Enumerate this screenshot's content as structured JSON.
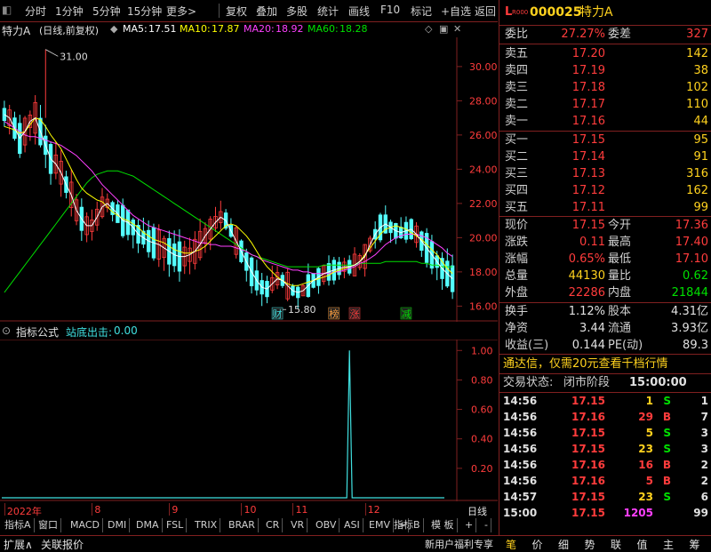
{
  "toolbar": {
    "left_items": [
      "分时",
      "1分钟",
      "5分钟",
      "15分钟",
      "更多>"
    ],
    "right_items": [
      "复权",
      "叠加",
      "多股",
      "统计",
      "画线",
      "F10",
      "标记",
      "+自选",
      "返回"
    ]
  },
  "chart_header": {
    "stock": "特力A",
    "mode": "(日线,前复权)",
    "ma5_label": "MA5:",
    "ma5": "17.51",
    "ma10_label": "MA10:",
    "ma10": "17.87",
    "ma20_label": "MA20:",
    "ma20": "18.92",
    "ma60_label": "MA60:",
    "ma60": "18.28"
  },
  "colors": {
    "up": "#ff3c3c",
    "down": "#54ffff",
    "ma5": "#ffffff",
    "ma10": "#ffff00",
    "ma20": "#ff40ff",
    "ma60": "#00e000",
    "frame": "#802020"
  },
  "chart_data": {
    "type": "candlestick",
    "ylim": [
      15.5,
      31.5
    ],
    "y_ticks": [
      "30.00",
      "28.00",
      "26.00",
      "24.00",
      "22.00",
      "20.00",
      "18.00",
      "16.00"
    ],
    "y_tick_values": [
      30,
      28,
      26,
      24,
      22,
      20,
      18,
      16
    ],
    "max_marker": "31.00",
    "min_marker": "15.80",
    "ma5": [
      27.2,
      27,
      26.4,
      25.8,
      26.2,
      26.8,
      27,
      26.2,
      25.4,
      24.6,
      24.3,
      23.8,
      23.1,
      22.5,
      21.6,
      21.1,
      20.7,
      20.7,
      21.2,
      21.8,
      22,
      21.7,
      21.4,
      21,
      20.9,
      20.6,
      20.2,
      20,
      19.8,
      19.7,
      19.6,
      19.4,
      19.2,
      19,
      18.9,
      18.9,
      19,
      19.2,
      19.6,
      20.1,
      20.5,
      20.9,
      21.2,
      21,
      20.4,
      19.8,
      19.2,
      18.6,
      18,
      17.5,
      17.1,
      17,
      17.3,
      17.6,
      17.5,
      17.2,
      16.9,
      16.8,
      16.9,
      17.2,
      17.5,
      17.7,
      17.9,
      18,
      18.1,
      18.2,
      18.3,
      18.3,
      18.4,
      18.6,
      18.9,
      19.6,
      20.2,
      20.6,
      20.8,
      20.6,
      20.4,
      20.3,
      20.4,
      20.5,
      20.2,
      19.8,
      19.4,
      19,
      18.6,
      18.2,
      17.9,
      17.6
    ],
    "ma10": [
      26.5,
      26.4,
      26.3,
      26.1,
      26.2,
      26.6,
      27,
      26.9,
      26.5,
      26,
      25.6,
      25.2,
      24.6,
      24,
      23.4,
      22.9,
      22.6,
      22.4,
      22.2,
      22.1,
      21.8,
      21.5,
      21.3,
      21.1,
      21,
      20.8,
      20.6,
      20.3,
      20.1,
      19.9,
      19.8,
      19.7,
      19.5,
      19.3,
      19.2,
      19.1,
      19.1,
      19.2,
      19.3,
      19.5,
      19.8,
      20.1,
      20.4,
      20.7,
      20.8,
      20.7,
      20.4,
      20.1,
      19.7,
      19.2,
      18.7,
      18.3,
      18,
      17.7,
      17.5,
      17.3,
      17.2,
      17.2,
      17.3,
      17.4,
      17.5,
      17.6,
      17.7,
      17.8,
      18,
      18.1,
      18.2,
      18.3,
      18.4,
      18.6,
      19,
      19.4,
      19.8,
      20.2,
      20.5,
      20.6,
      20.7,
      20.6,
      20.5,
      20.3,
      20.1,
      19.9,
      19.6,
      19.3,
      19,
      18.6,
      18.2,
      17.9
    ],
    "ma20": [
      26.8,
      26.6,
      26.4,
      26.2,
      26,
      25.9,
      25.9,
      25.8,
      25.7,
      25.6,
      25.5,
      25.4,
      25.2,
      25,
      24.8,
      24.5,
      24.2,
      23.9,
      23.5,
      23.1,
      22.8,
      22.5,
      22.2,
      21.9,
      21.6,
      21.3,
      21.1,
      20.9,
      20.7,
      20.6,
      20.5,
      20.4,
      20.3,
      20.2,
      20.1,
      20,
      19.9,
      19.8,
      19.7,
      19.7,
      19.6,
      19.6,
      19.5,
      19.5,
      19.5,
      19.4,
      19.3,
      19.2,
      19,
      18.9,
      18.7,
      18.6,
      18.5,
      18.4,
      18.3,
      18.2,
      18.1,
      18.1,
      18,
      18,
      17.9,
      17.9,
      17.9,
      17.9,
      18,
      18,
      18.1,
      18.2,
      18.3,
      18.5,
      18.6,
      18.8,
      19,
      19.3,
      19.6,
      19.8,
      20,
      20.1,
      20.2,
      20.2,
      20.2,
      20.1,
      20,
      19.8,
      19.6,
      19.4,
      19.1,
      18.9
    ],
    "ma60": [
      16.8,
      17.2,
      17.6,
      18,
      18.4,
      18.8,
      19.2,
      19.6,
      20,
      20.4,
      20.8,
      21.2,
      21.6,
      22,
      22.4,
      22.8,
      23.2,
      23.5,
      23.7,
      23.8,
      23.9,
      23.9,
      23.9,
      23.8,
      23.7,
      23.6,
      23.4,
      23.2,
      23,
      22.8,
      22.6,
      22.4,
      22.2,
      22,
      21.8,
      21.6,
      21.4,
      21.2,
      21,
      20.8,
      20.6,
      20.4,
      20.2,
      20,
      19.8,
      19.6,
      19.4,
      19.2,
      19,
      18.9,
      18.8,
      18.7,
      18.6,
      18.5,
      18.4,
      18.3,
      18.3,
      18.3,
      18.3,
      18.3,
      18.3,
      18.3,
      18.4,
      18.4,
      18.4,
      18.4,
      18.4,
      18.4,
      18.4,
      18.5,
      18.5,
      18.5,
      18.5,
      18.5,
      18.6,
      18.6,
      18.6,
      18.6,
      18.6,
      18.6,
      18.6,
      18.5,
      18.5,
      18.4,
      18.4,
      18.3,
      18.3,
      18.3
    ],
    "event_markers": [
      {
        "label": "财",
        "index": 53,
        "color": "#40e0e0"
      },
      {
        "label": "榜",
        "index": 64,
        "color": "#ffa040"
      },
      {
        "label": "涨",
        "index": 68,
        "color": "#ff3c3c"
      },
      {
        "label": "减",
        "index": 78,
        "color": "#00e000"
      }
    ],
    "x_labels": [
      {
        "label": "2022年",
        "index": 0
      },
      {
        "label": "8",
        "index": 17
      },
      {
        "label": "9",
        "index": 32
      },
      {
        "label": "10",
        "index": 46
      },
      {
        "label": "11",
        "index": 56
      },
      {
        "label": "12",
        "index": 70
      }
    ]
  },
  "indicator": {
    "title": "指标公式",
    "name": "站底出击:",
    "value": "0.00",
    "y_ticks": [
      "1.00",
      "0.80",
      "0.60",
      "0.40",
      "0.20"
    ],
    "y_tick_values": [
      1,
      0.8,
      0.6,
      0.4,
      0.2
    ],
    "spike_index": 67,
    "spike_value": 1.0,
    "right_label": "日线"
  },
  "bottom_tabs": [
    "指标A",
    "窗口",
    "MACD",
    "DMI",
    "DMA",
    "FSL",
    "TRIX",
    "BRAR",
    "CR",
    "VR",
    "OBV",
    "ASI",
    "EMV",
    ">"
  ],
  "bottom_tabs_right": [
    "指标B",
    "模 板",
    "+",
    "-"
  ],
  "bottom_bar": {
    "left": [
      "扩展∧",
      "关联报价"
    ],
    "promo": "新用户福利专享",
    "right_tabs": [
      "笔",
      "价",
      "细",
      "势",
      "联",
      "值",
      "主",
      "筹"
    ]
  },
  "quote": {
    "marker": "L",
    "marker_sub": "R000",
    "code": "000025",
    "name": "特力A",
    "weibi_label": "委比",
    "weibi": "27.27%",
    "weicha_label": "委差",
    "weicha": "327",
    "asks": [
      {
        "label": "卖五",
        "price": "17.20",
        "vol": "142"
      },
      {
        "label": "卖四",
        "price": "17.19",
        "vol": "38"
      },
      {
        "label": "卖三",
        "price": "17.18",
        "vol": "102"
      },
      {
        "label": "卖二",
        "price": "17.17",
        "vol": "110"
      },
      {
        "label": "卖一",
        "price": "17.16",
        "vol": "44"
      }
    ],
    "bids": [
      {
        "label": "买一",
        "price": "17.15",
        "vol": "95"
      },
      {
        "label": "买二",
        "price": "17.14",
        "vol": "91"
      },
      {
        "label": "买三",
        "price": "17.13",
        "vol": "316"
      },
      {
        "label": "买四",
        "price": "17.12",
        "vol": "162"
      },
      {
        "label": "买五",
        "price": "17.11",
        "vol": "99"
      }
    ],
    "stats": [
      {
        "l1": "现价",
        "v1": "17.15",
        "c1": "red",
        "l2": "今开",
        "v2": "17.36",
        "c2": "red"
      },
      {
        "l1": "涨跌",
        "v1": "0.11",
        "c1": "red",
        "l2": "最高",
        "v2": "17.40",
        "c2": "red"
      },
      {
        "l1": "涨幅",
        "v1": "0.65%",
        "c1": "red",
        "l2": "最低",
        "v2": "17.10",
        "c2": "red"
      },
      {
        "l1": "总量",
        "v1": "44130",
        "c1": "yellow",
        "l2": "量比",
        "v2": "0.62",
        "c2": "green"
      },
      {
        "l1": "外盘",
        "v1": "22286",
        "c1": "red",
        "l2": "内盘",
        "v2": "21844",
        "c2": "green"
      }
    ],
    "stats2": [
      {
        "l1": "换手",
        "v1": "1.12%",
        "l2": "股本",
        "v2": "4.31亿"
      },
      {
        "l1": "净资",
        "v1": "3.44",
        "l2": "流通",
        "v2": "3.93亿"
      },
      {
        "l1": "收益(三)",
        "v1": "0.144",
        "l2": "PE(动)",
        "v2": "89.3"
      }
    ],
    "promo": "通达信，仅需20元查看千档行情",
    "status_label": "交易状态:",
    "status_value": "闭市阶段",
    "status_time": "15:00:00",
    "ticks": [
      {
        "time": "14:56",
        "price": "17.15",
        "vol": "1",
        "side": "S",
        "n": "1"
      },
      {
        "time": "14:56",
        "price": "17.16",
        "vol": "29",
        "side": "B",
        "n": "7"
      },
      {
        "time": "14:56",
        "price": "17.15",
        "vol": "5",
        "side": "S",
        "n": "3"
      },
      {
        "time": "14:56",
        "price": "17.15",
        "vol": "23",
        "side": "S",
        "n": "3"
      },
      {
        "time": "14:56",
        "price": "17.16",
        "vol": "16",
        "side": "B",
        "n": "2"
      },
      {
        "time": "14:56",
        "price": "17.16",
        "vol": "5",
        "side": "B",
        "n": "2"
      },
      {
        "time": "14:57",
        "price": "17.15",
        "vol": "23",
        "side": "S",
        "n": "6"
      },
      {
        "time": "15:00",
        "price": "17.15",
        "vol": "1205",
        "side": "",
        "n": "99"
      }
    ]
  }
}
